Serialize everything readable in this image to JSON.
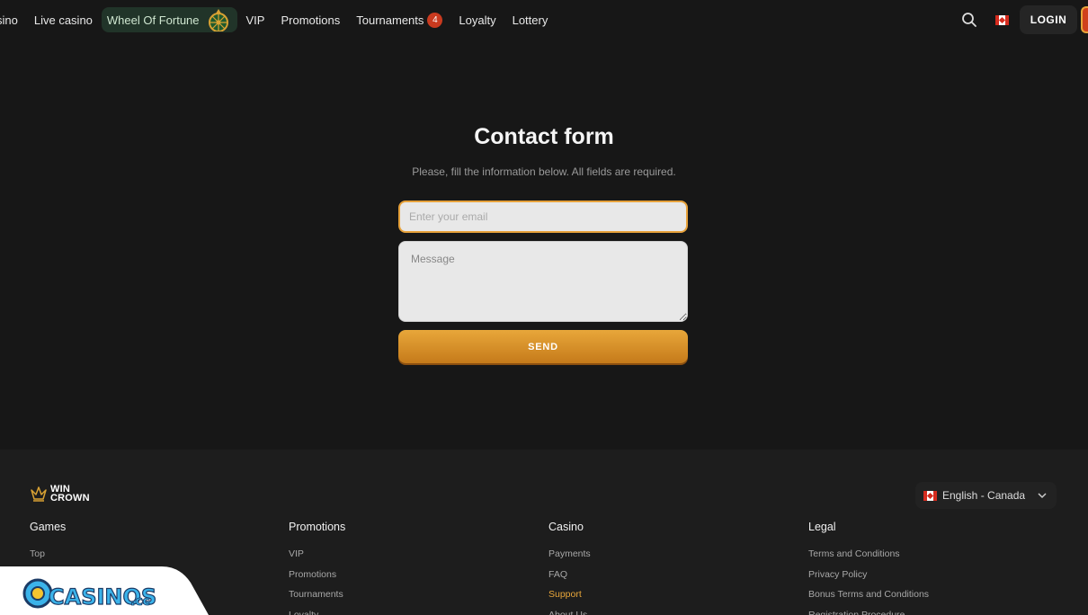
{
  "nav": {
    "items": [
      {
        "label": "sino"
      },
      {
        "label": "Live casino"
      },
      {
        "label": "Wheel Of Fortune"
      },
      {
        "label": "VIP"
      },
      {
        "label": "Promotions"
      },
      {
        "label": "Tournaments",
        "badge": "4"
      },
      {
        "label": "Loyalty"
      },
      {
        "label": "Lottery"
      }
    ],
    "login_label": "LOGIN"
  },
  "form": {
    "title": "Contact form",
    "subtitle": "Please, fill the information below. All fields are required.",
    "email_placeholder": "Enter your email",
    "message_placeholder": "Message",
    "send_label": "SEND"
  },
  "footer": {
    "logo_line1": "WIN",
    "logo_line2": "CROWN",
    "language": "English - Canada",
    "columns": [
      {
        "title": "Games",
        "links": [
          "Top"
        ]
      },
      {
        "title": "Promotions",
        "links": [
          "VIP",
          "Promotions",
          "Tournaments",
          "Loyalty"
        ]
      },
      {
        "title": "Casino",
        "links": [
          "Payments",
          "FAQ",
          "Support",
          "About Us"
        ],
        "active": "Support"
      },
      {
        "title": "Legal",
        "links": [
          "Terms and Conditions",
          "Privacy Policy",
          "Bonus Terms and Conditions",
          "Registration Procedure"
        ]
      }
    ]
  },
  "watermark": {
    "text": "CASINOS",
    "suffix": ".cc"
  },
  "colors": {
    "accent": "#e8a63a",
    "background": "#171717",
    "footer": "#1d1d1d",
    "badge": "#c93a1f"
  }
}
